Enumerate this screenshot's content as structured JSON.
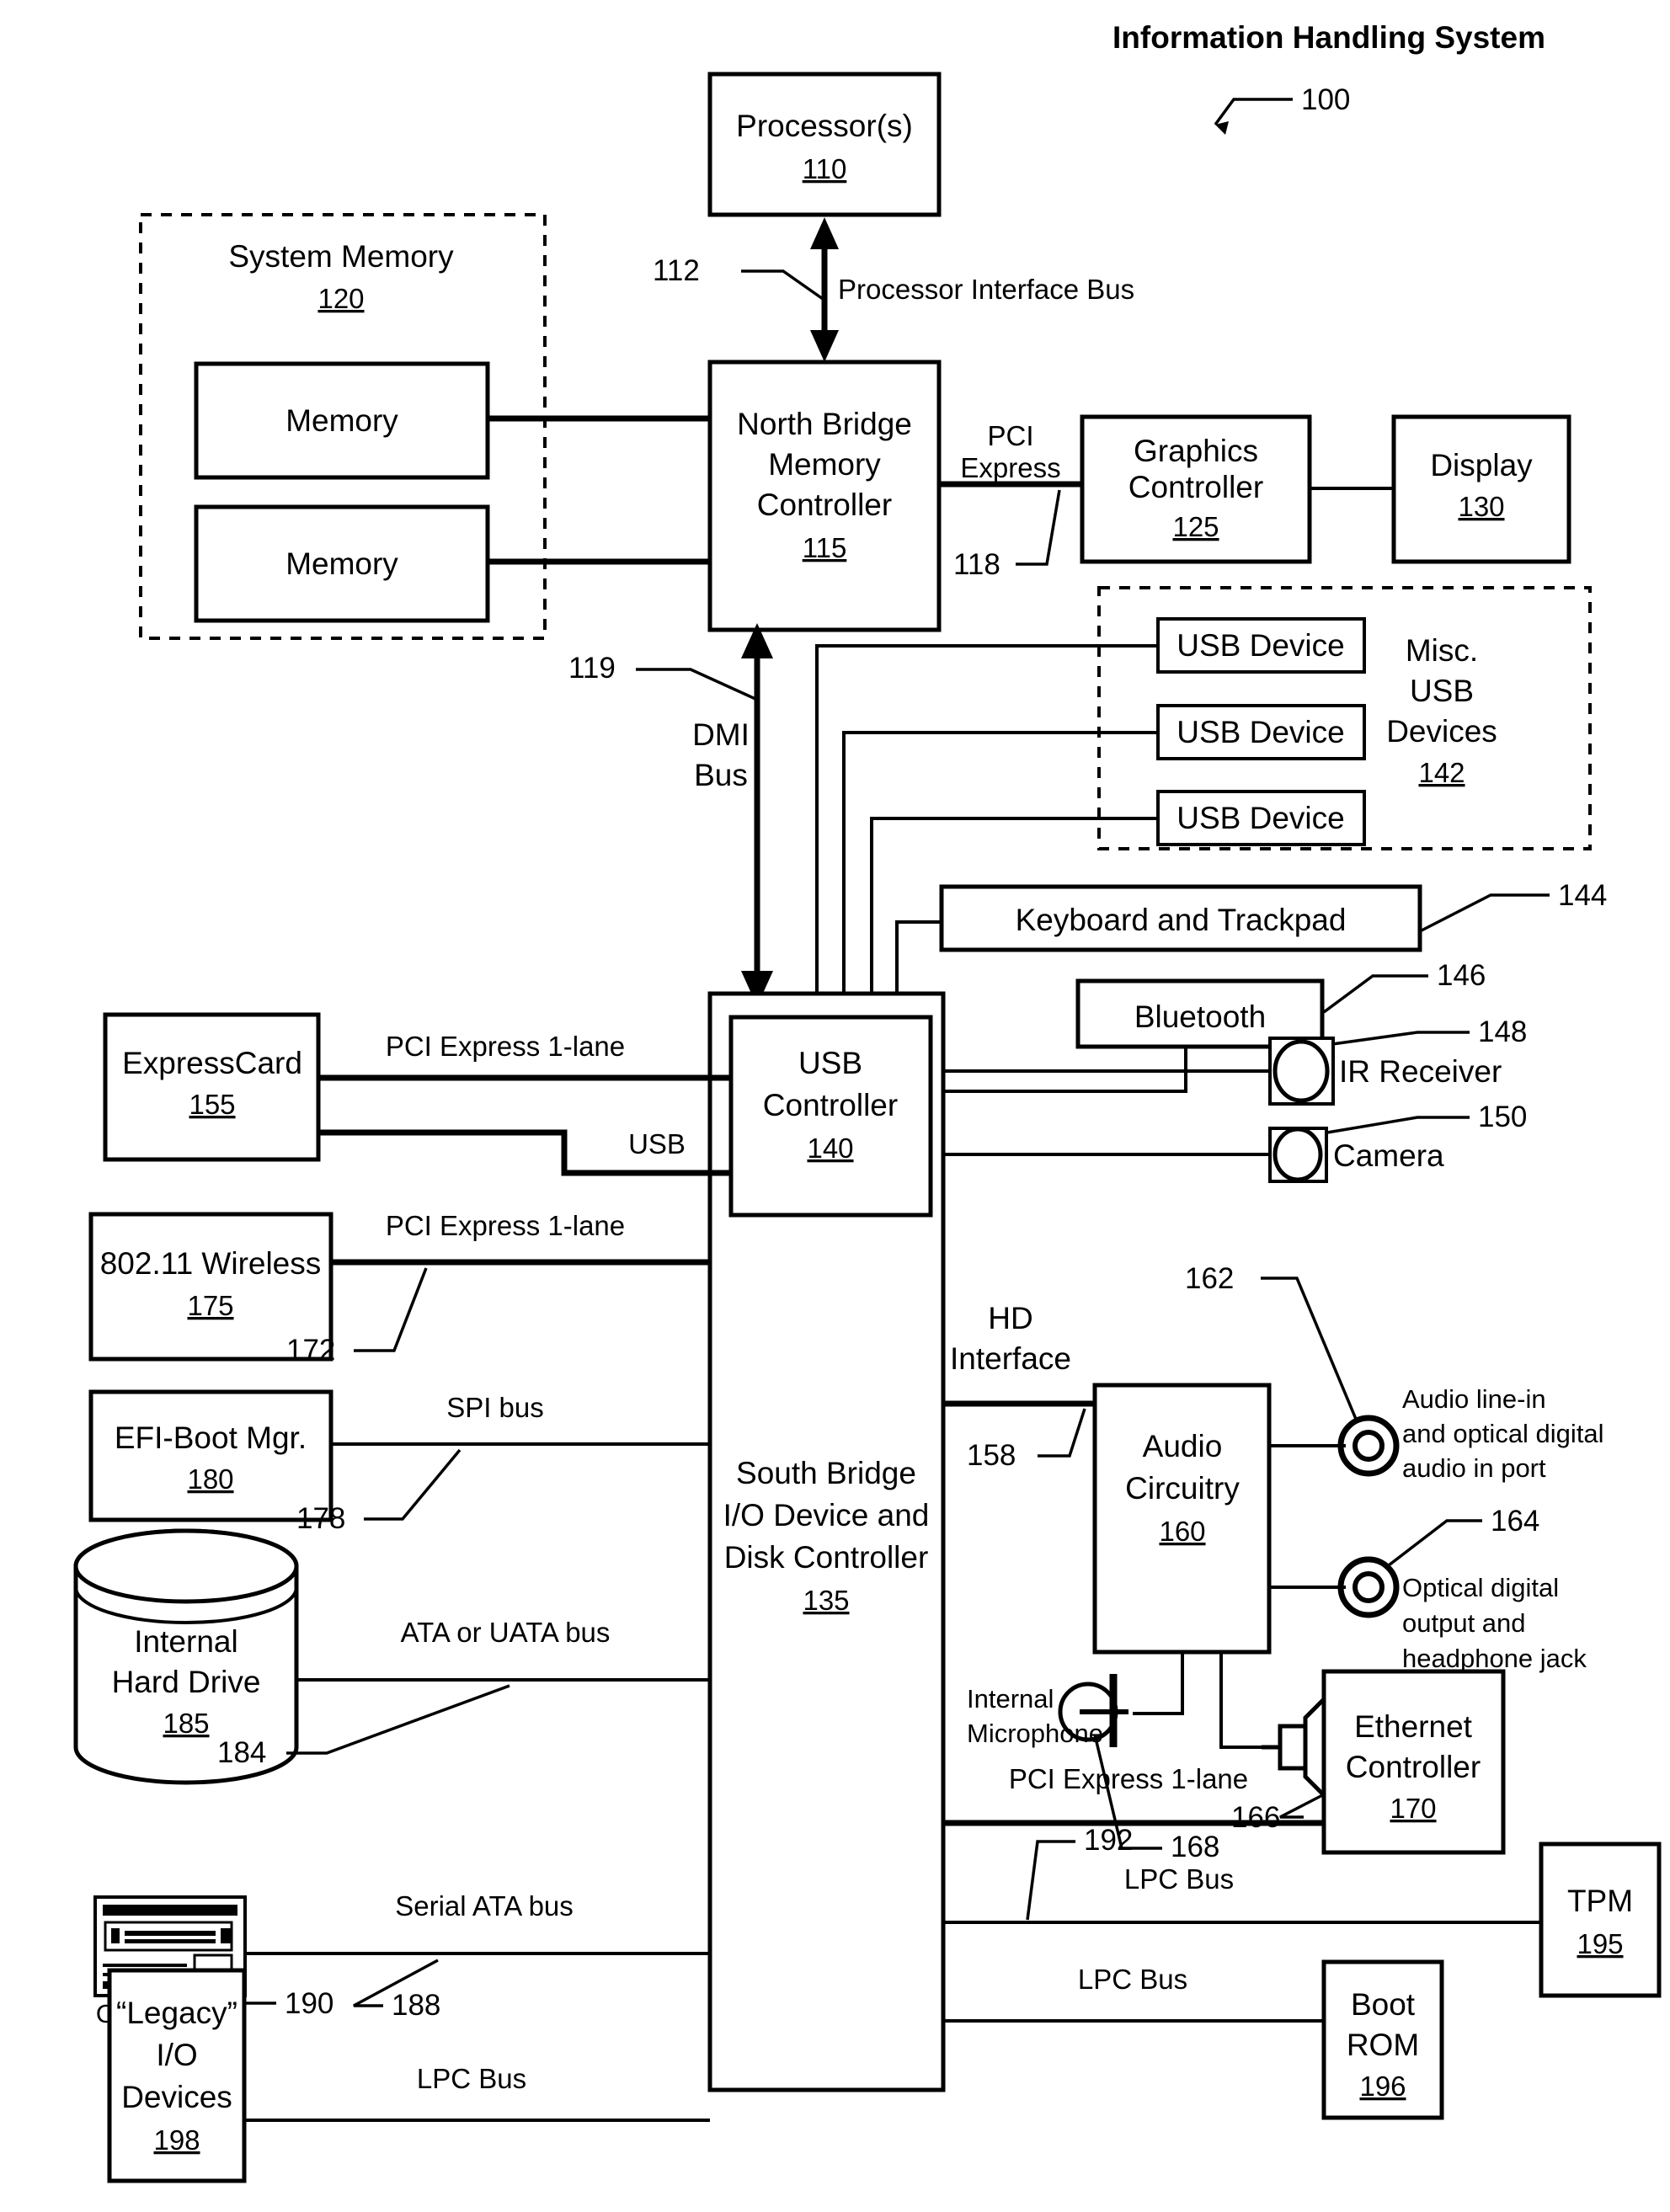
{
  "figure": {
    "title": "Information Handling System",
    "title_ref": "100"
  },
  "blocks": {
    "processor": {
      "label": "Processor(s)",
      "ref": "110"
    },
    "system_memory": {
      "label": "System Memory",
      "ref": "120"
    },
    "memory_1": {
      "label": "Memory"
    },
    "memory_2": {
      "label": "Memory"
    },
    "north_bridge": {
      "line1": "North Bridge",
      "line2": "Memory",
      "line3": "Controller",
      "ref": "115"
    },
    "graphics_controller": {
      "line1": "Graphics",
      "line2": "Controller",
      "ref": "125"
    },
    "display": {
      "label": "Display",
      "ref": "130"
    },
    "usb_device_1": {
      "label": "USB Device"
    },
    "usb_device_2": {
      "label": "USB Device"
    },
    "usb_device_3": {
      "label": "USB Device"
    },
    "misc_usb": {
      "line1": "Misc.",
      "line2": "USB",
      "line3": "Devices",
      "ref": "142"
    },
    "keyboard_trackpad": {
      "label": "Keyboard and Trackpad",
      "ref": "144"
    },
    "bluetooth": {
      "label": "Bluetooth",
      "ref": "146"
    },
    "ir_receiver": {
      "label": "IR Receiver",
      "ref": "148"
    },
    "camera": {
      "label": "Camera",
      "ref": "150"
    },
    "usb_controller": {
      "line1": "USB",
      "line2": "Controller",
      "ref": "140"
    },
    "south_bridge": {
      "line1": "South Bridge",
      "line2": "I/O Device and",
      "line3": "Disk Controller",
      "ref": "135"
    },
    "expresscard": {
      "label": "ExpressCard",
      "ref": "155"
    },
    "wireless": {
      "label": "802.11 Wireless",
      "ref": "175"
    },
    "efi_boot_mgr": {
      "label": "EFI-Boot Mgr.",
      "ref": "180"
    },
    "internal_hard_drive": {
      "line1": "Internal",
      "line2": "Hard Drive",
      "ref": "185"
    },
    "optical_drive": {
      "label": "Optical drive",
      "ref": "190"
    },
    "legacy_io": {
      "line1": "“Legacy”",
      "line2": "I/O",
      "line3": "Devices",
      "ref": "198"
    },
    "audio_circuitry": {
      "line1": "Audio",
      "line2": "Circuitry",
      "ref": "160"
    },
    "audio_line_in": {
      "line1": "Audio line-in",
      "line2": "and optical digital",
      "line3": "audio in port",
      "ref": "162"
    },
    "optical_digital_out": {
      "line1": "Optical digital",
      "line2": "output and",
      "line3": "headphone jack",
      "ref": "164"
    },
    "internal_microphone": {
      "line1": "Internal",
      "line2": "Microphone",
      "ref": "168"
    },
    "internal_speakers": {
      "line1": "Internal",
      "line2": "Speakers",
      "ref": "166"
    },
    "ethernet_controller": {
      "line1": "Ethernet",
      "line2": "Controller",
      "ref": "170"
    },
    "tpm": {
      "label": "TPM",
      "ref": "195"
    },
    "boot_rom": {
      "line1": "Boot",
      "line2": "ROM",
      "ref": "196"
    }
  },
  "buses": {
    "processor_interface": {
      "label": "Processor Interface Bus",
      "ref": "112"
    },
    "pci_express_graphics": {
      "line1": "PCI",
      "line2": "Express",
      "ref": "118"
    },
    "dmi": {
      "line1": "DMI",
      "line2": "Bus",
      "ref": "119"
    },
    "pcie_1lane_expresscard": {
      "label": "PCI Express 1-lane"
    },
    "usb_expresscard": {
      "label": "USB"
    },
    "pcie_1lane_wireless": {
      "label": "PCI Express 1-lane",
      "ref": "172"
    },
    "spi": {
      "label": "SPI bus",
      "ref": "178"
    },
    "ata_uata": {
      "label": "ATA or UATA bus",
      "ref": "184"
    },
    "serial_ata": {
      "label": "Serial ATA bus",
      "ref": "188"
    },
    "lpc_legacy": {
      "label": "LPC Bus"
    },
    "hd_interface": {
      "line1": "HD",
      "line2": "Interface",
      "ref": "158"
    },
    "pcie_1lane_ethernet": {
      "label": "PCI Express 1-lane"
    },
    "lpc_tpm": {
      "label": "LPC Bus",
      "ref": "192"
    },
    "lpc_bootrom": {
      "label": "LPC Bus"
    }
  }
}
